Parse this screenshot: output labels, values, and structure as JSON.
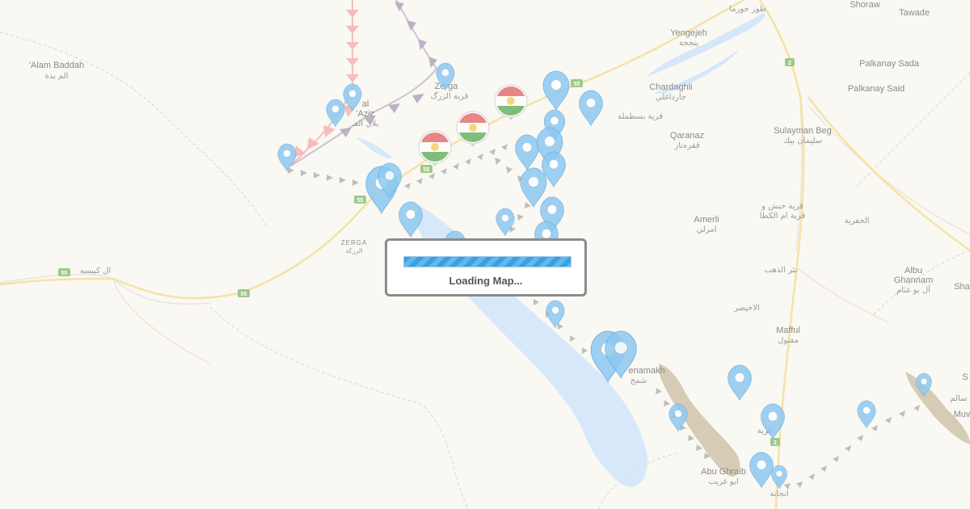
{
  "loading": {
    "text": "Loading Map..."
  },
  "places": {
    "alam_baddah_en": "'Alam Baddah",
    "alam_baddah_ar": "الم بدة",
    "yengejeh_en": "Yengejeh",
    "yengejeh_ar": "ينججة",
    "shoraw": "Shoraw",
    "tawade": "Tawade",
    "palkanay_sada": "Palkanay Sada",
    "palkanay_said": "Palkanay Said",
    "chardaghli_en": "Chardaghli",
    "chardaghli_ar": "جارداغلي",
    "basatamla_ar": "قرية بسطملة",
    "qaranaz_en": "Qaranaz",
    "qaranaz_ar": "قفرەناز",
    "sulayman_beg_en": "Sulayman Beg",
    "sulayman_beg_ar": "سليمان بيك",
    "habash_ar1": "قرية حبش و",
    "habash_ar2": "قرية ام الكطا",
    "hafria_ar": "الحفرية",
    "amerli_en": "Amerli",
    "amerli_ar": "امرلي",
    "zerga_en": "ZERGA",
    "zerga_ar": "الزركة",
    "zerga_town_en": "Zerga",
    "zerga_town_ar": "قرية الزرگ",
    "al_aziz_en1": "al",
    "al_aziz_en2": "'Aziz",
    "al_aziz_ar": "بلال العـ",
    "kubaysa_ar": "ال كبيسه",
    "bir_dhahab_ar": "بئر الذهب",
    "albu_ghannam_en1": "Albu",
    "albu_ghannam_en2": "Ghannam",
    "albu_ghannam_ar": "آل بو غنام",
    "sha": "Sha",
    "akhaydar_ar": "الاخيضر",
    "mafful_en": "Mafful",
    "mafful_ar": "مفتول",
    "enamakh_en": "enamakh",
    "enamakh_ar": "شمخ",
    "abu_ghraib_en": "Abu Ghraib",
    "abu_ghraib_ar": "ابو غريب",
    "khabba_ar": "قرية",
    "enjana_ar": "انجانة",
    "muv": "Muv",
    "s": "S",
    "salam_ar": "سالم",
    "tuz_ar": "طوز خورما"
  },
  "road_shields": [
    "55",
    "55",
    "55",
    "55",
    "55",
    "2",
    "2"
  ],
  "colors": {
    "background": "#faf8f2",
    "water": "#d3e6fb",
    "road": "#f5e2a6",
    "marker": "#8ec9f0",
    "front_line": "#b9b2c8",
    "red_line": "#f4a5a5",
    "terrain": "#cdbfa5",
    "loading_bar": "#2b92d6"
  },
  "marker_icons": [
    "location-pin-icon",
    "kurdistan-flag-icon"
  ]
}
